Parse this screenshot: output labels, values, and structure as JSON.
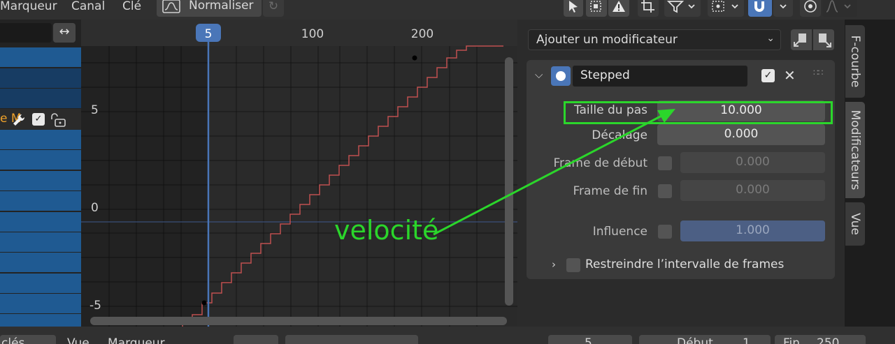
{
  "menu": {
    "marker": "Marqueur",
    "channel": "Canal",
    "key": "Clé",
    "normalize": "Normaliser"
  },
  "timeline": {
    "current_frame": "5",
    "ticks": [
      "100",
      "200"
    ],
    "y_ticks": [
      "5",
      "0",
      "-5"
    ]
  },
  "annotation": {
    "text": "velocité",
    "color": "#2bd62b"
  },
  "panel": {
    "add_modifier": "Ajouter un modificateur",
    "modifier_name": "Stepped",
    "step_size_label": "Taille du pas",
    "step_size_value": "10.000",
    "offset_label": "Décalage",
    "offset_value": "0.000",
    "start_frame_label": "Frame de début",
    "start_frame_value": "0.000",
    "end_frame_label": "Frame de fin",
    "end_frame_value": "0.000",
    "influence_label": "Influence",
    "influence_value": "1.000",
    "restrict_label": "Restreindre l’intervalle de frames"
  },
  "tabs": {
    "fcurve": "F-courbe",
    "modifiers": "Modificateurs",
    "view": "Vue"
  },
  "bottom": {
    "keys": "clés",
    "view": "Vue",
    "marker": "Marqueur",
    "frame": "5",
    "start_label": "Début",
    "start_value": "1",
    "end_label": "Fin",
    "end_value": "250"
  },
  "colors": {
    "accent_blue": "#4a76b8",
    "curve": "#c05050",
    "highlight": "#2bd62b"
  }
}
